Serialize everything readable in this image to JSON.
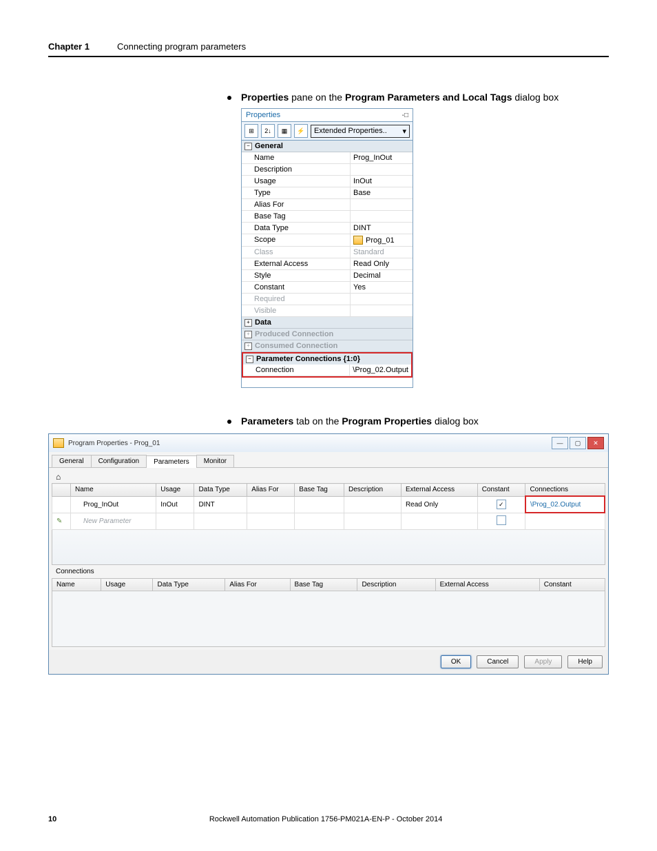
{
  "header": {
    "chapter": "Chapter 1",
    "title": "Connecting program parameters"
  },
  "bullet1": {
    "prefix": "Properties",
    "mid": " pane on the ",
    "bold2": "Program Parameters and Local Tags",
    "suffix": " dialog box"
  },
  "bullet2": {
    "prefix": "Parameters",
    "mid": " tab on the ",
    "bold2": "Program Properties",
    "suffix": " dialog box"
  },
  "props": {
    "title": "Properties",
    "toolbar": {
      "btn1": "⊞",
      "btn2": "2↓",
      "btn3": "▦",
      "btn4": "⚡",
      "search_label": "Extended Properties..",
      "drop_icon": "▾"
    },
    "sections": {
      "general": "General",
      "data": "Data",
      "produced": "Produced Connection",
      "consumed": "Consumed Connection",
      "param_conn": "Parameter Connections {1:0}"
    },
    "rows": {
      "name_k": "Name",
      "name_v": "Prog_InOut",
      "desc_k": "Description",
      "desc_v": "",
      "usage_k": "Usage",
      "usage_v": "InOut",
      "type_k": "Type",
      "type_v": "Base",
      "aliasfor_k": "Alias For",
      "aliasfor_v": "",
      "basetag_k": "Base Tag",
      "basetag_v": "",
      "datatype_k": "Data Type",
      "datatype_v": "DINT",
      "scope_k": "Scope",
      "scope_v": "Prog_01",
      "class_k": "Class",
      "class_v": "Standard",
      "extacc_k": "External Access",
      "extacc_v": "Read Only",
      "style_k": "Style",
      "style_v": "Decimal",
      "constant_k": "Constant",
      "constant_v": "Yes",
      "required_k": "Required",
      "required_v": "",
      "visible_k": "Visible",
      "visible_v": "",
      "connection_k": "Connection",
      "connection_v": "\\Prog_02.Output"
    },
    "exp_minus": "−",
    "exp_plus": "+"
  },
  "pp": {
    "title": "Program Properties - Prog_01",
    "tabs": {
      "general": "General",
      "configuration": "Configuration",
      "parameters": "Parameters",
      "monitor": "Monitor"
    },
    "home": "⌂",
    "grid_headers": {
      "name": "Name",
      "usage": "Usage",
      "datatype": "Data Type",
      "aliasfor": "Alias For",
      "basetag": "Base Tag",
      "description": "Description",
      "extaccess": "External Access",
      "constant": "Constant",
      "connections": "Connections"
    },
    "row1": {
      "name": "Prog_InOut",
      "usage": "InOut",
      "datatype": "DINT",
      "extaccess": "Read Only",
      "constant_check": "✓",
      "connections": "\\Prog_02.Output"
    },
    "newparam": "New Parameter",
    "connections_label": "Connections",
    "grid2_headers": {
      "name": "Name",
      "usage": "Usage",
      "datatype": "Data Type",
      "aliasfor": "Alias For",
      "basetag": "Base Tag",
      "description": "Description",
      "extaccess": "External Access",
      "constant": "Constant"
    },
    "buttons": {
      "ok": "OK",
      "cancel": "Cancel",
      "apply": "Apply",
      "help": "Help"
    },
    "winbtns": {
      "min": "—",
      "max": "▢",
      "close": "✕"
    }
  },
  "footer": {
    "page": "10",
    "pub": "Rockwell Automation Publication 1756-PM021A-EN-P - October 2014"
  }
}
